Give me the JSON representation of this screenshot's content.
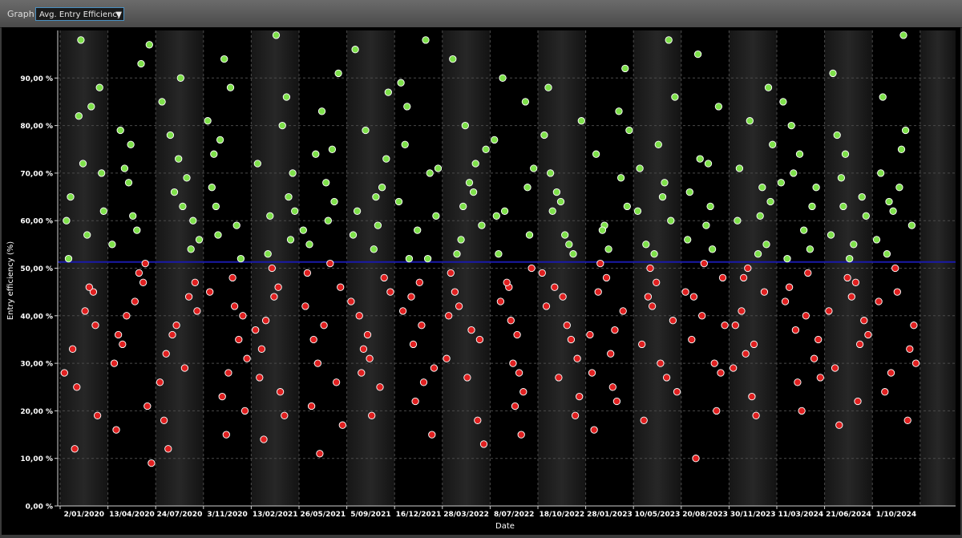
{
  "toolbar": {
    "graph_label": "Graph",
    "graph_select_value": "Avg. Entry Efficiency"
  },
  "chart_data": {
    "type": "scatter",
    "xlabel": "Date",
    "ylabel": "Entry efficiency (%)",
    "ylim": [
      0,
      100
    ],
    "y_ticks": [
      "0,00 %",
      "10,00 %",
      "20,00 %",
      "30,00 %",
      "40,00 %",
      "50,00 %",
      "60,00 %",
      "70,00 %",
      "80,00 %",
      "90,00 %"
    ],
    "x_ticks": [
      "2/01/2020",
      "13/04/2020",
      "24/07/2020",
      "3/11/2020",
      "13/02/2021",
      "26/05/2021",
      "5/09/2021",
      "16/12/2021",
      "28/03/2022",
      "8/07/2022",
      "18/10/2022",
      "28/01/2023",
      "10/05/2023",
      "20/08/2023",
      "30/11/2023",
      "11/03/2024",
      "21/06/2024",
      "1/10/2024"
    ],
    "average_line": 51.3,
    "grid": true,
    "colors": {
      "above_average": "#7ee04a",
      "below_average": "#e02020",
      "average_line": "#1a1aa8"
    },
    "series": [
      {
        "name": "",
        "points_per_band": [
          [
            28,
            82,
            45,
            60,
            98,
            38,
            52,
            72,
            19,
            65,
            41,
            88,
            33,
            57,
            70,
            12,
            46,
            62,
            25,
            84
          ],
          [
            55,
            40,
            93,
            30,
            68,
            47,
            16,
            76,
            51,
            36,
            61,
            21,
            79,
            43,
            97,
            34,
            58,
            9,
            71,
            49
          ],
          [
            26,
            66,
            44,
            85,
            38,
            54,
            18,
            73,
            60,
            32,
            90,
            47,
            12,
            63,
            41,
            78,
            29,
            56,
            36,
            69
          ],
          [
            81,
            23,
            59,
            45,
            94,
            35,
            67,
            15,
            52,
            74,
            28,
            40,
            63,
            88,
            20,
            57,
            48,
            31,
            77,
            42
          ],
          [
            37,
            61,
            19,
            72,
            50,
            86,
            27,
            44,
            65,
            33,
            99,
            56,
            14,
            46,
            70,
            39,
            24,
            62,
            53,
            80
          ],
          [
            58,
            30,
            75,
            42,
            11,
            64,
            49,
            83,
            26,
            55,
            38,
            91,
            21,
            68,
            46,
            35,
            60,
            17,
            74,
            51
          ],
          [
            43,
            79,
            25,
            57,
            36,
            67,
            96,
            31,
            48,
            62,
            19,
            73,
            40,
            54,
            87,
            28,
            65,
            45,
            33,
            59
          ],
          [
            64,
            34,
            52,
            89,
            22,
            70,
            41,
            58,
            15,
            76,
            47,
            29,
            84,
            38,
            61,
            52,
            26,
            71,
            44,
            98
          ],
          [
            31,
            56,
            72,
            40,
            63,
            18,
            49,
            80,
            35,
            94,
            27,
            59,
            45,
            68,
            13,
            53,
            37,
            75,
            42,
            66
          ],
          [
            77,
            46,
            24,
            61,
            39,
            85,
            53,
            30,
            67,
            43,
            21,
            57,
            90,
            36,
            50,
            62,
            28,
            71,
            47,
            15
          ],
          [
            49,
            66,
            35,
            78,
            27,
            53,
            42,
            64,
            19,
            88,
            44,
            31,
            70,
            57,
            23,
            62,
            38,
            81,
            46,
            55
          ],
          [
            36,
            59,
            83,
            28,
            48,
            69,
            16,
            54,
            41,
            74,
            32,
            92,
            45,
            25,
            63,
            51,
            37,
            79,
            58,
            22
          ],
          [
            62,
            42,
            27,
            71,
            53,
            98,
            34,
            47,
            60,
            18,
            76,
            39,
            55,
            30,
            86,
            44,
            65,
            24,
            50,
            68
          ],
          [
            45,
            73,
            30,
            56,
            40,
            20,
            66,
            51,
            84,
            35,
            59,
            28,
            44,
            72,
            48,
            10,
            63,
            38,
            95,
            54
          ],
          [
            29,
            50,
            67,
            38,
            81,
            45,
            60,
            23,
            55,
            71,
            34,
            88,
            41,
            19,
            64,
            48,
            53,
            76,
            32,
            61
          ],
          [
            68,
            37,
            54,
            85,
            26,
            63,
            43,
            74,
            31,
            52,
            20,
            67,
            46,
            58,
            35,
            80,
            40,
            27,
            70,
            49
          ],
          [
            41,
            63,
            22,
            57,
            74,
            34,
            91,
            48,
            65,
            29,
            52,
            39,
            78,
            44,
            61,
            17,
            55,
            36,
            69,
            47
          ],
          [
            56,
            28,
            79,
            43,
            62,
            18,
            70,
            50,
            33,
            86,
            45,
            59,
            24,
            67,
            38,
            53,
            75,
            30,
            64,
            99
          ]
        ]
      }
    ]
  }
}
